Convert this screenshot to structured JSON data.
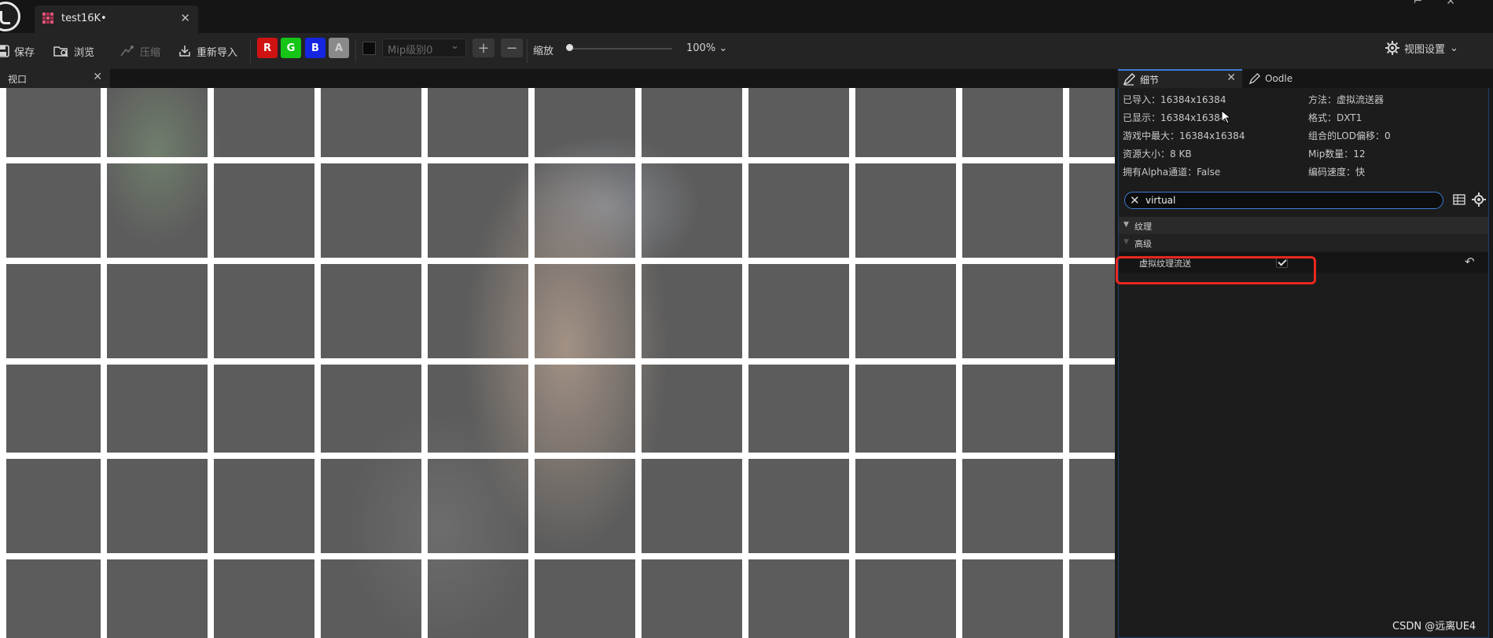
{
  "window": {
    "asset_tab_label": "test16K•",
    "logo_icon": "unreal-engine-logo"
  },
  "toolbar": {
    "save_label": "保存",
    "browse_label": "浏览",
    "compress_label": "压缩",
    "reimport_label": "重新导入",
    "channels": [
      {
        "label": "R",
        "bg": "#d01212",
        "fg": "#ffffff"
      },
      {
        "label": "G",
        "bg": "#16c516",
        "fg": "#ffffff"
      },
      {
        "label": "B",
        "bg": "#1525e0",
        "fg": "#ffffff"
      },
      {
        "label": "A",
        "bg": "#8a8a8a",
        "fg": "#cfcfcf"
      }
    ],
    "mip_level_value": "Mip级别0",
    "plus_label": "+",
    "minus_label": "−",
    "zoom_label": "缩放",
    "zoom_value": "100%",
    "view_settings_label": "视图设置"
  },
  "viewport": {
    "tab_label": "视口"
  },
  "details": {
    "tab_label": "细节",
    "oodle_tab_label": "Oodle",
    "info_left": [
      "已导入：16384x16384",
      "已显示：16384x16384",
      "游戏中最大：16384x16384",
      "资源大小：8 KB",
      "拥有Alpha通道：False"
    ],
    "info_right": [
      "方法：虚拟流送器",
      "格式：DXT1",
      "组合的LOD偏移：0",
      "Mip数量：12",
      "编码速度：快"
    ],
    "search_value": "virtual",
    "category_texture": "纹理",
    "category_advanced": "高级",
    "property_label": "虚拟纹理流送",
    "property_checked": true
  },
  "watermark": "CSDN @远离UE4",
  "colors": {
    "accent": "#3d7bd6",
    "highlight": "#e8281f"
  }
}
